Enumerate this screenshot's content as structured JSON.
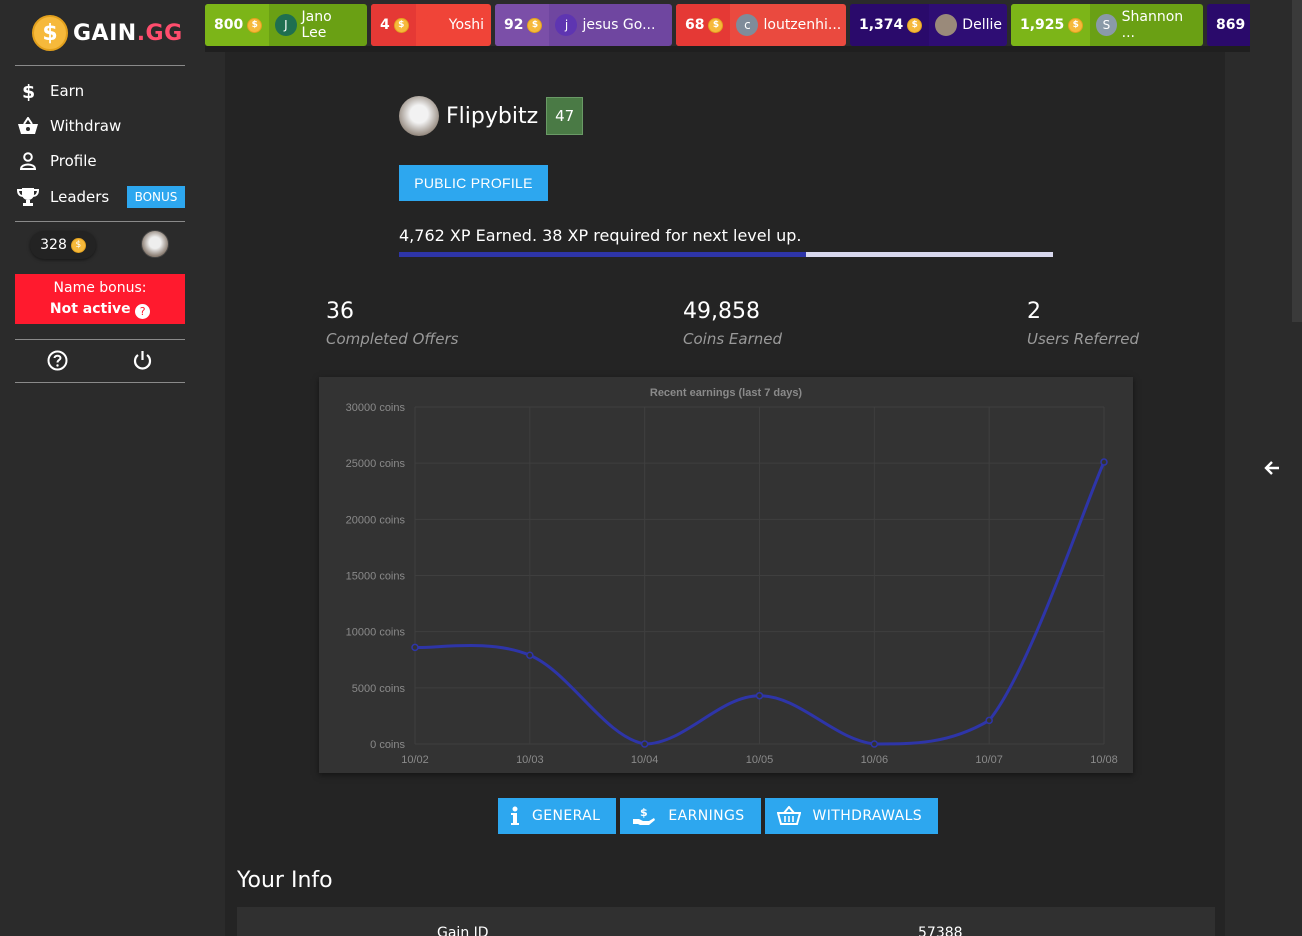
{
  "brand": {
    "name": "GAIN",
    "suffix": ".GG",
    "coin_glyph": "$"
  },
  "sidebar": {
    "items": [
      {
        "label": "Earn",
        "icon": "dollar-icon"
      },
      {
        "label": "Withdraw",
        "icon": "basket-icon"
      },
      {
        "label": "Profile",
        "icon": "user-icon"
      },
      {
        "label": "Leaders",
        "icon": "trophy-icon"
      }
    ],
    "bonus_tag": "BONUS",
    "balance": "328",
    "name_bonus": {
      "title": "Name bonus:",
      "status": "Not active"
    }
  },
  "feed": [
    {
      "amount": "800",
      "user": "Jano Lee",
      "initial": "J",
      "amt_color": "#7cb518",
      "usr_color": "#6aa014",
      "av_color": "#1f6f50"
    },
    {
      "amount": "4",
      "user": "Yoshi",
      "initial": "",
      "amt_color": "#e53935",
      "usr_color": "#f04438",
      "av_color": "#f04438"
    },
    {
      "amount": "92",
      "user": "jesus Go...",
      "initial": "j",
      "amt_color": "#7b4fa8",
      "usr_color": "#6f46a0",
      "av_color": "#5e35b1"
    },
    {
      "amount": "68",
      "user": "loutzenhi...",
      "initial": "c",
      "amt_color": "#e53935",
      "usr_color": "#ea4a3f",
      "av_color": "#7f8c9a"
    },
    {
      "amount": "1,374",
      "user": "Dellie",
      "initial": "",
      "amt_color": "#2a0a6b",
      "usr_color": "#2e0d74",
      "av_color": "#9a8a7a"
    },
    {
      "amount": "1,925",
      "user": "Shannon ...",
      "initial": "S",
      "amt_color": "#7cb518",
      "usr_color": "#6aa014",
      "av_color": "#8a9aa8"
    },
    {
      "amount": "869",
      "user": "",
      "initial": "",
      "amt_color": "#2a0a6b",
      "usr_color": "#2a0a6b",
      "av_color": "#2a0a6b"
    }
  ],
  "profile": {
    "username": "Flipybitz",
    "level": "47",
    "public_profile_btn": "PUBLIC PROFILE",
    "xp_text": "4,762 XP Earned. 38 XP required for next level up.",
    "xp_progress": 0.623
  },
  "stats": [
    {
      "value": "36",
      "label": "Completed Offers"
    },
    {
      "value": "49,858",
      "label": "Coins Earned"
    },
    {
      "value": "2",
      "label": "Users Referred"
    }
  ],
  "chart_data": {
    "type": "line",
    "title": "Recent earnings (last 7 days)",
    "categories": [
      "10/02",
      "10/03",
      "10/04",
      "10/05",
      "10/06",
      "10/07",
      "10/08"
    ],
    "values": [
      8600,
      7900,
      0,
      4300,
      0,
      2100,
      25100
    ],
    "ylim": [
      0,
      30000
    ],
    "yticks": [
      "0 coins",
      "5000 coins",
      "10000 coins",
      "15000 coins",
      "20000 coins",
      "25000 coins",
      "30000 coins"
    ],
    "grid": true,
    "line_color": "#2e35a8"
  },
  "tabs": [
    {
      "label": "GENERAL",
      "icon": "info-icon"
    },
    {
      "label": "EARNINGS",
      "icon": "hand-coin-icon"
    },
    {
      "label": "WITHDRAWALS",
      "icon": "basket-icon"
    }
  ],
  "your_info": {
    "title": "Your Info",
    "rows": [
      {
        "key": "Gain ID",
        "value": "57388"
      }
    ]
  }
}
